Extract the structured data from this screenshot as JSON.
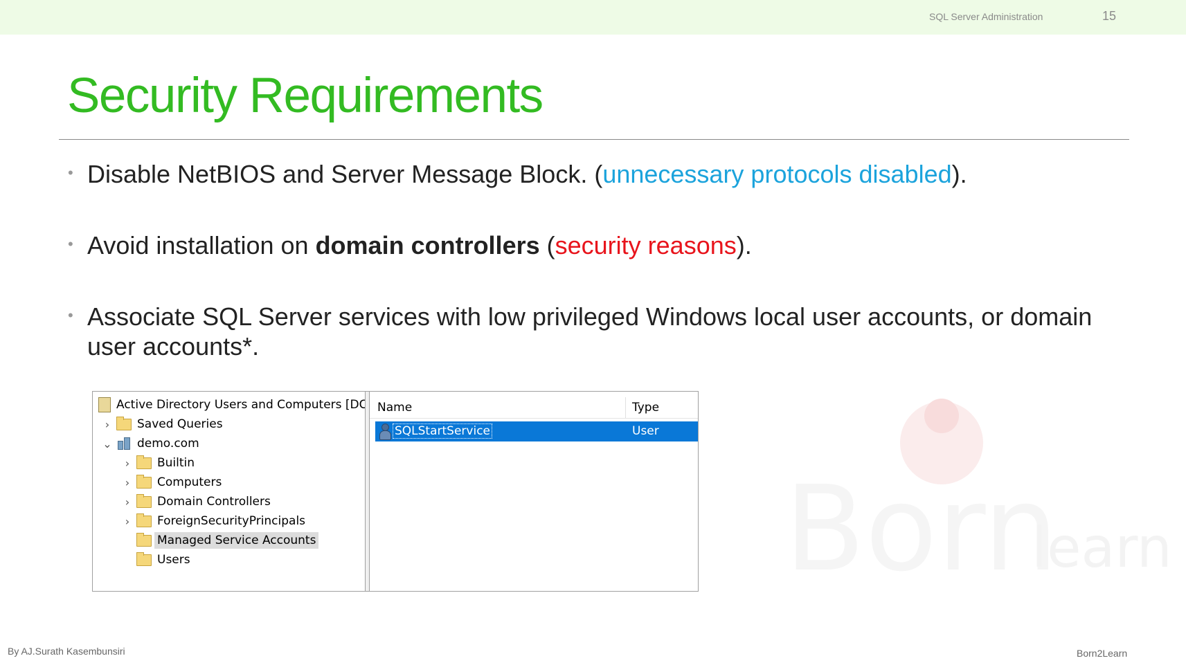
{
  "header": {
    "course": "SQL Server  Administration",
    "page_number": "15"
  },
  "slide": {
    "title": "Security Requirements",
    "bullets": [
      {
        "parts": [
          "Disable NetBIOS and Server Message Block. (",
          "unnecessary protocols disabled",
          ")."
        ]
      },
      {
        "parts": [
          "Avoid installation on ",
          "domain controllers",
          " (",
          "security reasons",
          ")."
        ]
      },
      {
        "text": "Associate SQL Server services with low privileged Windows local user accounts, or domain user accounts*."
      }
    ]
  },
  "ad_console": {
    "tree": [
      {
        "label": "Active Directory Users and Computers [DC.d",
        "icon": "console-root-icon"
      },
      {
        "label": "Saved Queries",
        "icon": "folder-icon"
      },
      {
        "label": "demo.com",
        "icon": "domain-icon"
      },
      {
        "label": "Builtin",
        "icon": "folder-icon"
      },
      {
        "label": "Computers",
        "icon": "folder-icon"
      },
      {
        "label": "Domain Controllers",
        "icon": "ou-folder-icon"
      },
      {
        "label": "ForeignSecurityPrincipals",
        "icon": "folder-icon"
      },
      {
        "label": "Managed Service Accounts",
        "icon": "folder-icon",
        "selected": true
      },
      {
        "label": "Users",
        "icon": "folder-icon"
      }
    ],
    "columns": [
      "Name",
      "Type"
    ],
    "rows": [
      {
        "name": "SQLStartService",
        "type": "User",
        "icon": "user-icon",
        "selected": true
      }
    ],
    "selection_color": "#0a78d7"
  },
  "watermark": {
    "born": "Born",
    "learn": "learn"
  },
  "footer": {
    "author": "By AJ.Surath Kasembunsiri",
    "brand": "Born2Learn"
  },
  "colors": {
    "title": "#33bb22",
    "highlight_blue": "#1ba3dc",
    "highlight_red": "#e8141c",
    "top_band": "#eefbe6"
  }
}
